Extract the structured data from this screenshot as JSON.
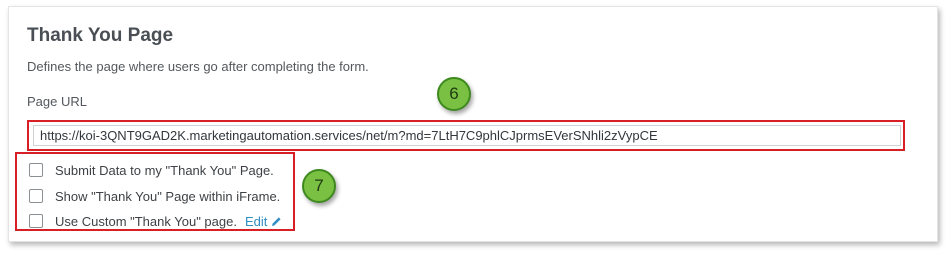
{
  "section": {
    "title": "Thank You Page",
    "description": "Defines the page where users go after completing the form."
  },
  "page_url": {
    "label": "Page URL",
    "value": "https://koi-3QNT9GAD2K.marketingautomation.services/net/m?md=7LtH7C9phlCJprmsEVerSNhli2zVypCE"
  },
  "options": [
    {
      "label": "Submit Data to my \"Thank You\" Page.",
      "checked": false
    },
    {
      "label": "Show \"Thank You\" Page within iFrame.",
      "checked": false
    },
    {
      "label": "Use Custom \"Thank You\" page.",
      "checked": false
    }
  ],
  "edit_link": {
    "label": "Edit",
    "icon": "pencil-icon"
  },
  "callouts": [
    "6",
    "7"
  ],
  "colors": {
    "highlight": "#d91f26",
    "badge_fill": "#7ac043",
    "link": "#2f8ec4"
  }
}
